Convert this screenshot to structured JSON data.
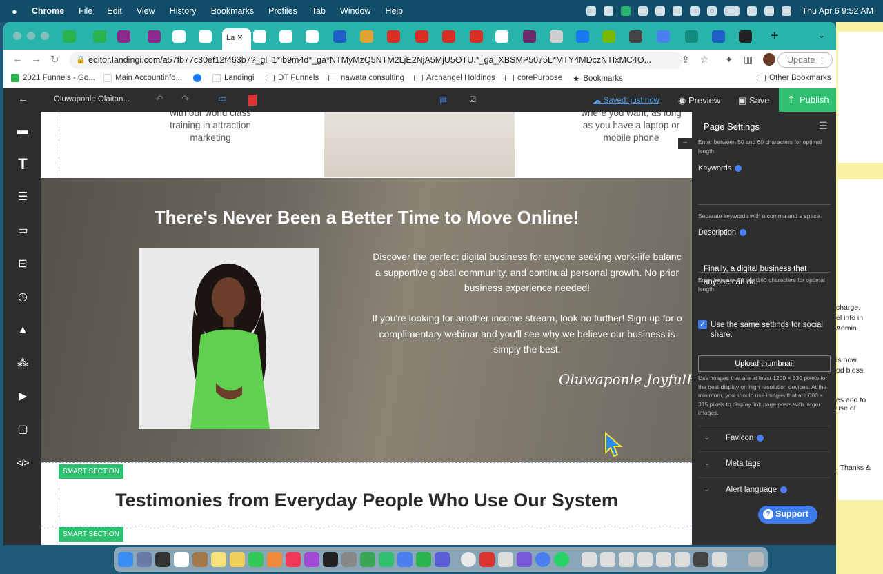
{
  "menubar": {
    "app": "Chrome",
    "items": [
      "File",
      "Edit",
      "View",
      "History",
      "Bookmarks",
      "Profiles",
      "Tab",
      "Window",
      "Help"
    ],
    "clock": "Thu Apr 6  9:52 AM"
  },
  "browser": {
    "active_tab": "La",
    "url": "editor.landingi.com/a57fb77c30ef12f463b7?_gl=1*ib9m4d*_ga*NTMyMzQ5NTM2LjE2NjA5MjU5OTU.*_ga_XBSMP5075L*MTY4MDczNTIxMC4O...",
    "update_label": "Update",
    "bookmarks": [
      "2021 Funnels - Go...",
      "Main Accountinfo...",
      "Landingi",
      "DT Funnels",
      "nawata consulting",
      "Archangel Holdings",
      "corePurpose",
      "Bookmarks",
      "Other Bookmarks"
    ]
  },
  "editor": {
    "page_name": "Oluwaponle Olaitan...",
    "saved": "Saved: just now",
    "preview": "Preview",
    "save": "Save",
    "publish": "Publish"
  },
  "canvas": {
    "feature_left": [
      "with our world class",
      "training in attraction",
      "marketing"
    ],
    "feature_right": [
      "where you want, as long",
      "as you have a laptop or",
      "mobile phone"
    ],
    "hero_title": "There's Never Been a Better Time to Move Online!",
    "hero_p1": [
      "Discover the perfect digital business for anyone seeking work-life balanc",
      "a supportive global community, and continual personal growth. No prior",
      "business experience needed!"
    ],
    "hero_p2": [
      "If you're looking for another income stream, look no further! Sign up for o",
      "complimentary webinar and you'll see why we believe our business is",
      "simply the best."
    ],
    "signature": "Oluwaponle JoyfulHeart",
    "section_badge": "SMART SECTION",
    "testimonies_title": "Testimonies from Everyday People Who Use Our System"
  },
  "panel": {
    "title": "Page Settings",
    "title_hint": "Enter between 50 and 60 characters for optimal length",
    "keywords_label": "Keywords",
    "keywords_hint": "Separate keywords with a comma and a space",
    "description_label": "Description",
    "description_value": "Finally, a digital business that anyone can do!",
    "description_hint": "Enter between 50 and 160 characters for optimal length",
    "social_checkbox": "Use the same settings for social share.",
    "upload_label": "Upload thumbnail",
    "upload_hint": "Use images that are at least 1200 × 630 pixels for the best display on high resolution devices. At the minimum, you should use images that are 600 × 315 pixels to display link page posts with larger images.",
    "accordions": [
      "Favicon",
      "Meta tags",
      "Alert language"
    ]
  },
  "support_label": "Support",
  "sticky_notes": [
    "charge.",
    "el info in",
    "Admin",
    "is now",
    "od bless,",
    "es and to",
    "use of",
    ". Thanks &"
  ]
}
